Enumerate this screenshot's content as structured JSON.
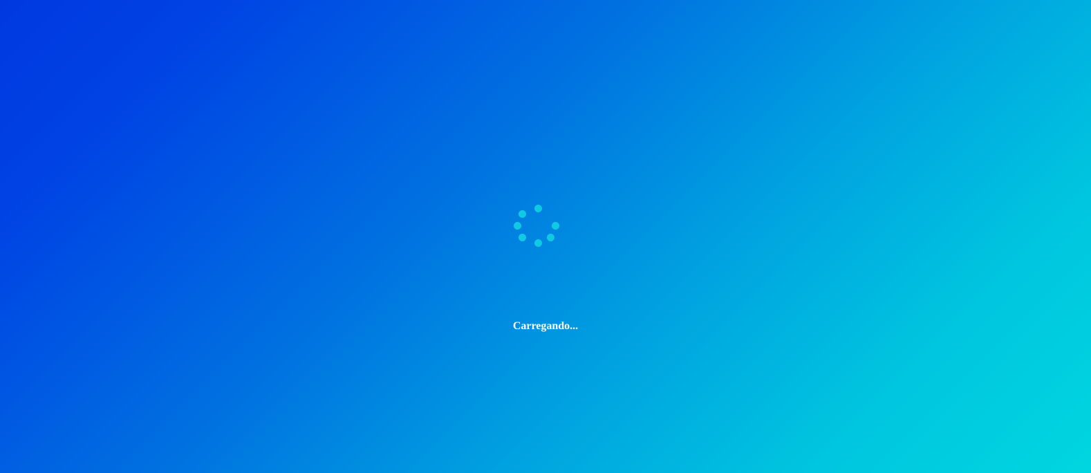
{
  "loader": {
    "text": "Carregando...",
    "spinner_icon": "loading-spinner-icon",
    "dot_count": 7
  },
  "colors": {
    "gradient_start": "#0038e0",
    "gradient_end": "#00d6e0",
    "spinner_dot": "#10c9e3",
    "text": "#ffffff"
  }
}
